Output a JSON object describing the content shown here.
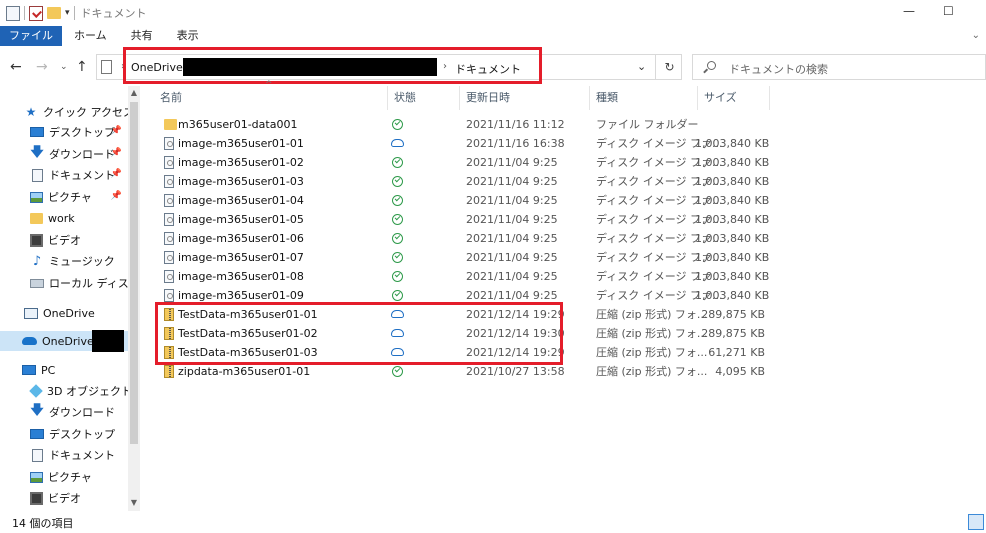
{
  "window": {
    "title": "ドキュメント",
    "minimize": "—",
    "maximize": "☐"
  },
  "ribbon": {
    "tabs": [
      "ファイル",
      "ホーム",
      "共有",
      "表示"
    ]
  },
  "address": {
    "root": "OneDrive",
    "current": "ドキュメント",
    "search_placeholder": "ドキュメントの検索"
  },
  "sidebar": {
    "quick_access": "クイック アクセス",
    "items": [
      {
        "label": "デスクトップ",
        "icon": "desktop-icon",
        "pinned": true
      },
      {
        "label": "ダウンロード",
        "icon": "download-icon",
        "pinned": true
      },
      {
        "label": "ドキュメント",
        "icon": "document-icon",
        "pinned": true
      },
      {
        "label": "ピクチャ",
        "icon": "pictures-icon",
        "pinned": true
      },
      {
        "label": "work",
        "icon": "folder-icon",
        "pinned": false
      },
      {
        "label": "ビデオ",
        "icon": "video-icon",
        "pinned": false
      },
      {
        "label": "ミュージック",
        "icon": "music-icon",
        "pinned": false
      },
      {
        "label": "ローカル ディスク (C",
        "icon": "drive-icon",
        "pinned": false
      }
    ],
    "onedrive": "OneDrive",
    "onedrive_business": "OneDrive -",
    "pc": "PC",
    "pc_items": [
      {
        "label": "3D オブジェクト",
        "icon": "3d-objects-icon"
      },
      {
        "label": "ダウンロード",
        "icon": "download-icon"
      },
      {
        "label": "デスクトップ",
        "icon": "desktop-icon"
      },
      {
        "label": "ドキュメント",
        "icon": "document-icon"
      },
      {
        "label": "ピクチャ",
        "icon": "pictures-icon"
      },
      {
        "label": "ビデオ",
        "icon": "video-icon"
      }
    ]
  },
  "columns": {
    "name": "名前",
    "status": "状態",
    "modified": "更新日時",
    "type": "種類",
    "size": "サイズ"
  },
  "files": [
    {
      "name": "m365user01-data001",
      "kind": "folder",
      "status": "synced",
      "modified": "2021/11/16 11:12",
      "type": "ファイル フォルダー",
      "size": ""
    },
    {
      "name": "image-m365user01-01",
      "kind": "disk",
      "status": "cloud",
      "modified": "2021/11/16 16:38",
      "type": "ディスク イメージ ファ...",
      "size": "1,003,840 KB"
    },
    {
      "name": "image-m365user01-02",
      "kind": "disk",
      "status": "synced",
      "modified": "2021/11/04 9:25",
      "type": "ディスク イメージ ファ...",
      "size": "1,003,840 KB"
    },
    {
      "name": "image-m365user01-03",
      "kind": "disk",
      "status": "synced",
      "modified": "2021/11/04 9:25",
      "type": "ディスク イメージ ファ...",
      "size": "1,003,840 KB"
    },
    {
      "name": "image-m365user01-04",
      "kind": "disk",
      "status": "synced",
      "modified": "2021/11/04 9:25",
      "type": "ディスク イメージ ファ...",
      "size": "1,003,840 KB"
    },
    {
      "name": "image-m365user01-05",
      "kind": "disk",
      "status": "synced",
      "modified": "2021/11/04 9:25",
      "type": "ディスク イメージ ファ...",
      "size": "1,003,840 KB"
    },
    {
      "name": "image-m365user01-06",
      "kind": "disk",
      "status": "synced",
      "modified": "2021/11/04 9:25",
      "type": "ディスク イメージ ファ...",
      "size": "1,003,840 KB"
    },
    {
      "name": "image-m365user01-07",
      "kind": "disk",
      "status": "synced",
      "modified": "2021/11/04 9:25",
      "type": "ディスク イメージ ファ...",
      "size": "1,003,840 KB"
    },
    {
      "name": "image-m365user01-08",
      "kind": "disk",
      "status": "synced",
      "modified": "2021/11/04 9:25",
      "type": "ディスク イメージ ファ...",
      "size": "1,003,840 KB"
    },
    {
      "name": "image-m365user01-09",
      "kind": "disk",
      "status": "synced",
      "modified": "2021/11/04 9:25",
      "type": "ディスク イメージ ファ...",
      "size": "1,003,840 KB"
    },
    {
      "name": "TestData-m365user01-01",
      "kind": "zip",
      "status": "cloud",
      "modified": "2021/12/14 19:29",
      "type": "圧縮 (zip 形式) フォ...",
      "size": "289,875 KB"
    },
    {
      "name": "TestData-m365user01-02",
      "kind": "zip",
      "status": "cloud",
      "modified": "2021/12/14 19:30",
      "type": "圧縮 (zip 形式) フォ...",
      "size": "289,875 KB"
    },
    {
      "name": "TestData-m365user01-03",
      "kind": "zip",
      "status": "cloud",
      "modified": "2021/12/14 19:29",
      "type": "圧縮 (zip 形式) フォ...",
      "size": "61,271 KB"
    },
    {
      "name": "zipdata-m365user01-01",
      "kind": "zip",
      "status": "synced",
      "modified": "2021/10/27 13:58",
      "type": "圧縮 (zip 形式) フォ...",
      "size": "4,095 KB"
    }
  ],
  "statusbar": {
    "item_count": "14 個の項目"
  },
  "colors": {
    "accent": "#1f63b5",
    "highlight": "#e41d2a",
    "synced": "#2e9a4a",
    "cloud": "#1f6fc4",
    "folder": "#f3c85a"
  }
}
